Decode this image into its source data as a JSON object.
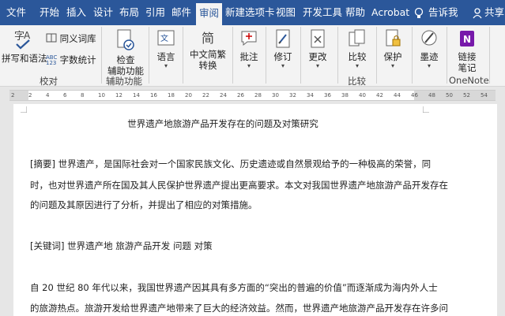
{
  "tabs": [
    {
      "label": "文件"
    },
    {
      "label": "开始"
    },
    {
      "label": "插入"
    },
    {
      "label": "设计"
    },
    {
      "label": "布局"
    },
    {
      "label": "引用"
    },
    {
      "label": "邮件"
    },
    {
      "label": "审阅"
    },
    {
      "label": "新建选项卡"
    },
    {
      "label": "视图"
    },
    {
      "label": "开发工具"
    },
    {
      "label": "帮助"
    },
    {
      "label": "Acrobat"
    },
    {
      "label": "告诉我"
    },
    {
      "label": "共享"
    }
  ],
  "ribbon": {
    "proofing": {
      "spelling": "拼写和语法",
      "thesaurus": "同义词库",
      "wordcount": "字数统计",
      "wordcount_badge": "ABC 123",
      "group": "校对"
    },
    "accessibility": {
      "line1": "检查",
      "line2": "辅助功能",
      "group": "辅助功能"
    },
    "language": {
      "label": "语言"
    },
    "chinese": {
      "glyph": "简",
      "line1": "中文简繁",
      "line2": "转换"
    },
    "comments": {
      "label": "批注"
    },
    "tracking": {
      "label": "修订"
    },
    "changes": {
      "label": "更改"
    },
    "compare": {
      "label": "比较",
      "group": "比较"
    },
    "protect": {
      "label": "保护"
    },
    "ink": {
      "label": "墨迹"
    },
    "onenote": {
      "line1": "链接",
      "line2": "笔记",
      "group": "OneNote"
    }
  },
  "ruler": {
    "numbers": [
      "2",
      "2",
      "4",
      "6",
      "8",
      "10",
      "12",
      "14",
      "16",
      "18",
      "20",
      "22",
      "24",
      "26",
      "28",
      "30",
      "32",
      "34",
      "36",
      "38",
      "40",
      "42",
      "44",
      "46",
      "48",
      "50",
      "52",
      "54"
    ]
  },
  "document": {
    "title": "世界遗产地旅游产品开发存在的问题及对策研究",
    "abstract_line1": "[摘要] 世界遗产，是国际社会对一个国家民族文化、历史遗迹或自然景观给予的一种极高的荣誉，同",
    "abstract_line2": "时，也对世界遗产所在国及其人民保护世界遗产提出更高要求。本文对我国世界遗产地旅游产品开发存在",
    "abstract_line3": "的问题及其原因进行了分析，并提出了相应的对策措施。",
    "keywords": "[关键词]  世界遗产地    旅游产品开发    问题    对策",
    "body_line1": "自 20 世纪 80 年代以来，我国世界遗产因其具有多方面的“突出的普遍的价值”而逐渐成为海内外人士",
    "body_line2": "的旅游热点。旅游开发给世界遗产地带来了巨大的经济效益。然而，世界遗产地旅游产品开发存在许多问"
  },
  "colors": {
    "tabbar": "#2b579a",
    "ribbon": "#f3f3f3",
    "onenote": "#7719aa"
  }
}
